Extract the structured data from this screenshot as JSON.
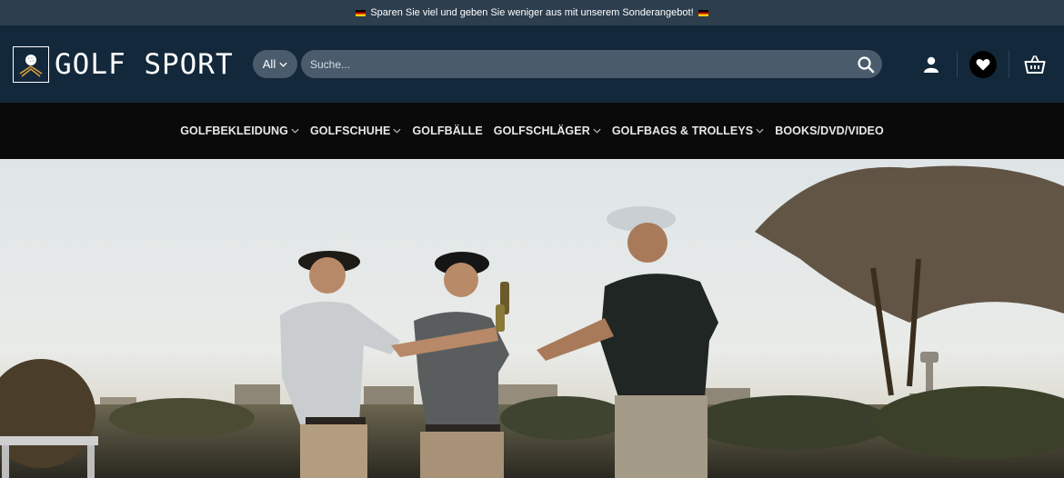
{
  "promo": {
    "text": "Sparen Sie viel und geben Sie weniger aus mit unserem Sonderangebot!"
  },
  "brand": {
    "name": "GOLF SPORT"
  },
  "search": {
    "category": "All",
    "placeholder": "Suche..."
  },
  "nav": {
    "items": [
      {
        "label": "GOLFBEKLEIDUNG",
        "has_dropdown": true
      },
      {
        "label": "GOLFSCHUHE",
        "has_dropdown": true
      },
      {
        "label": "GOLFBÄLLE",
        "has_dropdown": false
      },
      {
        "label": "GOLFSCHLÄGER",
        "has_dropdown": true
      },
      {
        "label": "GOLFBAGS & TROLLEYS",
        "has_dropdown": true
      },
      {
        "label": "BOOKS/DVD/VIDEO",
        "has_dropdown": false
      }
    ]
  },
  "icons": {
    "account": "user-icon",
    "wishlist": "heart-icon",
    "cart": "basket-icon"
  },
  "colors": {
    "topbar": "#2d3e4e",
    "header": "#13283a",
    "nav": "#0a0a0a",
    "search_bg": "#4a5c6c"
  }
}
